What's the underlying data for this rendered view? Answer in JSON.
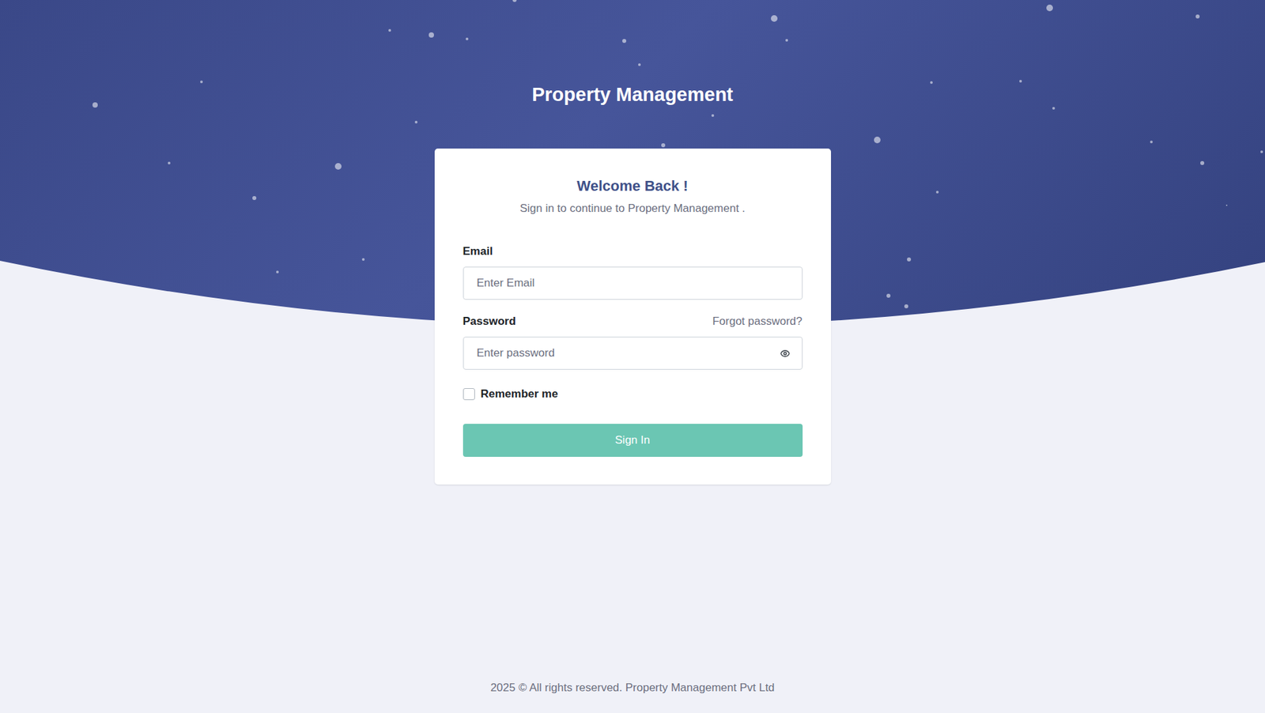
{
  "header": {
    "title": "Property Management"
  },
  "card": {
    "title": "Welcome Back !",
    "subtitle": "Sign in to continue to Property Management ."
  },
  "form": {
    "email": {
      "label": "Email",
      "placeholder": "Enter Email"
    },
    "password": {
      "label": "Password",
      "placeholder": "Enter password",
      "forgot": "Forgot password?"
    },
    "remember": {
      "label": "Remember me",
      "checked": false
    },
    "submit": "Sign In"
  },
  "footer": "2025 © All rights reserved. Property Management Pvt Ltd"
}
